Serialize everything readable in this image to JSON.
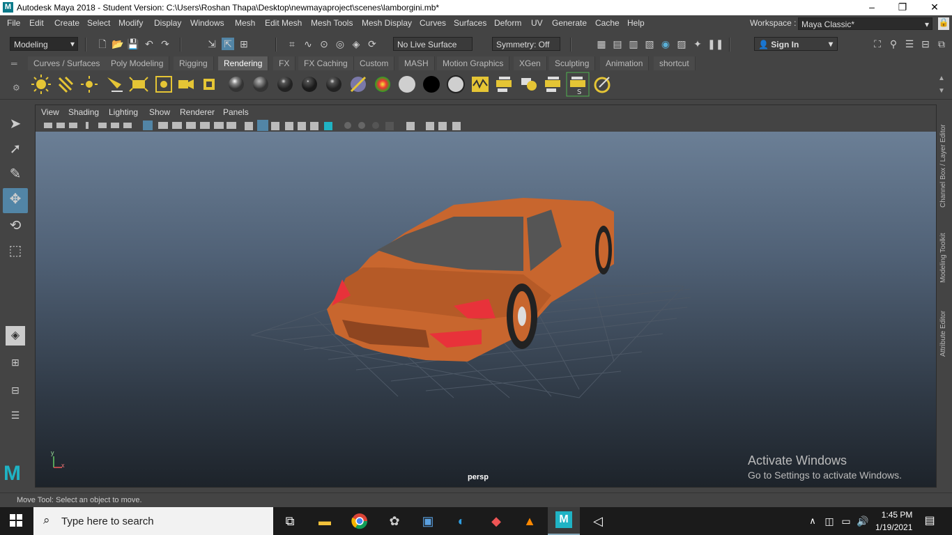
{
  "titlebar": {
    "logo_letter": "M",
    "title": "Autodesk Maya 2018 - Student Version: C:\\Users\\Roshan Thapa\\Desktop\\newmayaproject\\scenes\\lamborgini.mb*",
    "minimize": "–",
    "restore": "❐",
    "close": "✕"
  },
  "menubar": {
    "items": [
      "File",
      "Edit",
      "Create",
      "Select",
      "Modify",
      "Display",
      "Windows",
      "Mesh",
      "Edit Mesh",
      "Mesh Tools",
      "Mesh Display",
      "Curves",
      "Surfaces",
      "Deform",
      "UV",
      "Generate",
      "Cache",
      "Help"
    ],
    "workspace_label": "Workspace :",
    "workspace_value": "Maya Classic*"
  },
  "statusline": {
    "menuset": "Modeling",
    "live_surface": "No Live Surface",
    "symmetry": "Symmetry: Off",
    "sign_in": "Sign In"
  },
  "shelf_tabs": [
    "Curves / Surfaces",
    "Poly Modeling",
    "Rigging",
    "Rendering",
    "FX",
    "FX Caching",
    "Custom",
    "MASH",
    "Motion Graphics",
    "XGen",
    "Sculpting",
    "Animation",
    "shortcut"
  ],
  "active_shelf_tab": "Rendering",
  "panel": {
    "menu": [
      "View",
      "Shading",
      "Lighting",
      "Show",
      "Renderer",
      "Panels"
    ],
    "camera": "persp"
  },
  "activation": {
    "line1": "Activate Windows",
    "line2": "Go to Settings to activate Windows."
  },
  "right_tabs": [
    "Channel Box / Layer Editor",
    "Modeling Toolkit",
    "Attribute Editor"
  ],
  "help_line": "Move Tool: Select an object to move.",
  "axis": {
    "y": "y",
    "x": "x"
  },
  "taskbar": {
    "search_placeholder": "Type here to search",
    "time": "1:45 PM",
    "date": "1/19/2021"
  },
  "colors": {
    "car_body": "#c8662e",
    "headlight": "#e8323a",
    "ui_bg": "#444444",
    "active_tab": "#5d5d5d"
  }
}
